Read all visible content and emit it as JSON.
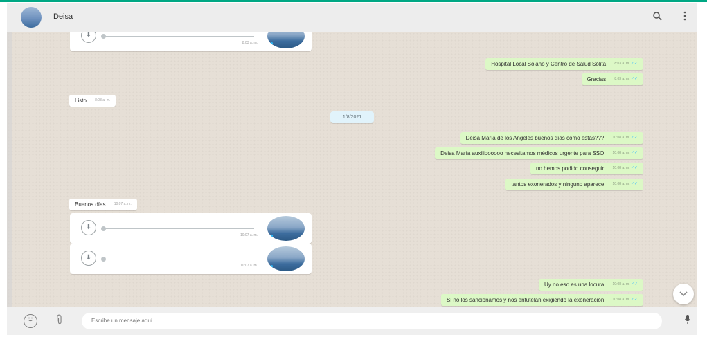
{
  "header": {
    "contact_name": "Deisa",
    "search_icon": "search-icon",
    "menu_icon": "menu-dots-icon"
  },
  "date_separator": "1/8/2021",
  "messages": [
    {
      "direction": "in",
      "type": "audio",
      "time": "8:03 a. m."
    },
    {
      "direction": "out",
      "text": "Hospital Local Solano y Centro de Salud Sólita",
      "time": "8:03 a. m."
    },
    {
      "direction": "out",
      "text": "Gracias",
      "time": "8:03 a. m."
    },
    {
      "direction": "in",
      "text": "Listo",
      "time": "8:03 a. m."
    },
    {
      "direction": "out",
      "text": "Deisa María de los Angeles buenos días como estás???",
      "time": "10:08 a. m."
    },
    {
      "direction": "out",
      "text": "Deisa María auxilioooooo necesitamos médicos urgente para SSO",
      "time": "10:08 a. m."
    },
    {
      "direction": "out",
      "text": "no hemos podido conseguir",
      "time": "10:08 a. m."
    },
    {
      "direction": "out",
      "text": "tantos exonerados y ninguno aparece",
      "time": "10:08 a. m."
    },
    {
      "direction": "in",
      "text": "Buenos días",
      "time": "10:07 a. m."
    },
    {
      "direction": "in",
      "type": "audio",
      "time": "10:07 a. m."
    },
    {
      "direction": "in",
      "type": "audio",
      "time": "10:07 a. m."
    },
    {
      "direction": "out",
      "text": "Uy no eso es una locura",
      "time": "10:08 a. m."
    },
    {
      "direction": "out",
      "text": "Si no los sancionamos y nos entutelan exigiendo la exoneración",
      "time": "10:08 a. m."
    }
  ],
  "composer": {
    "placeholder": "Escribe un mensaje aquí"
  },
  "colors": {
    "outgoing_bubble": "#dcf8c6",
    "incoming_bubble": "#ffffff",
    "chat_background": "#e6dfd6",
    "accent": "#00a884",
    "read_ticks": "#4fc3f7"
  }
}
